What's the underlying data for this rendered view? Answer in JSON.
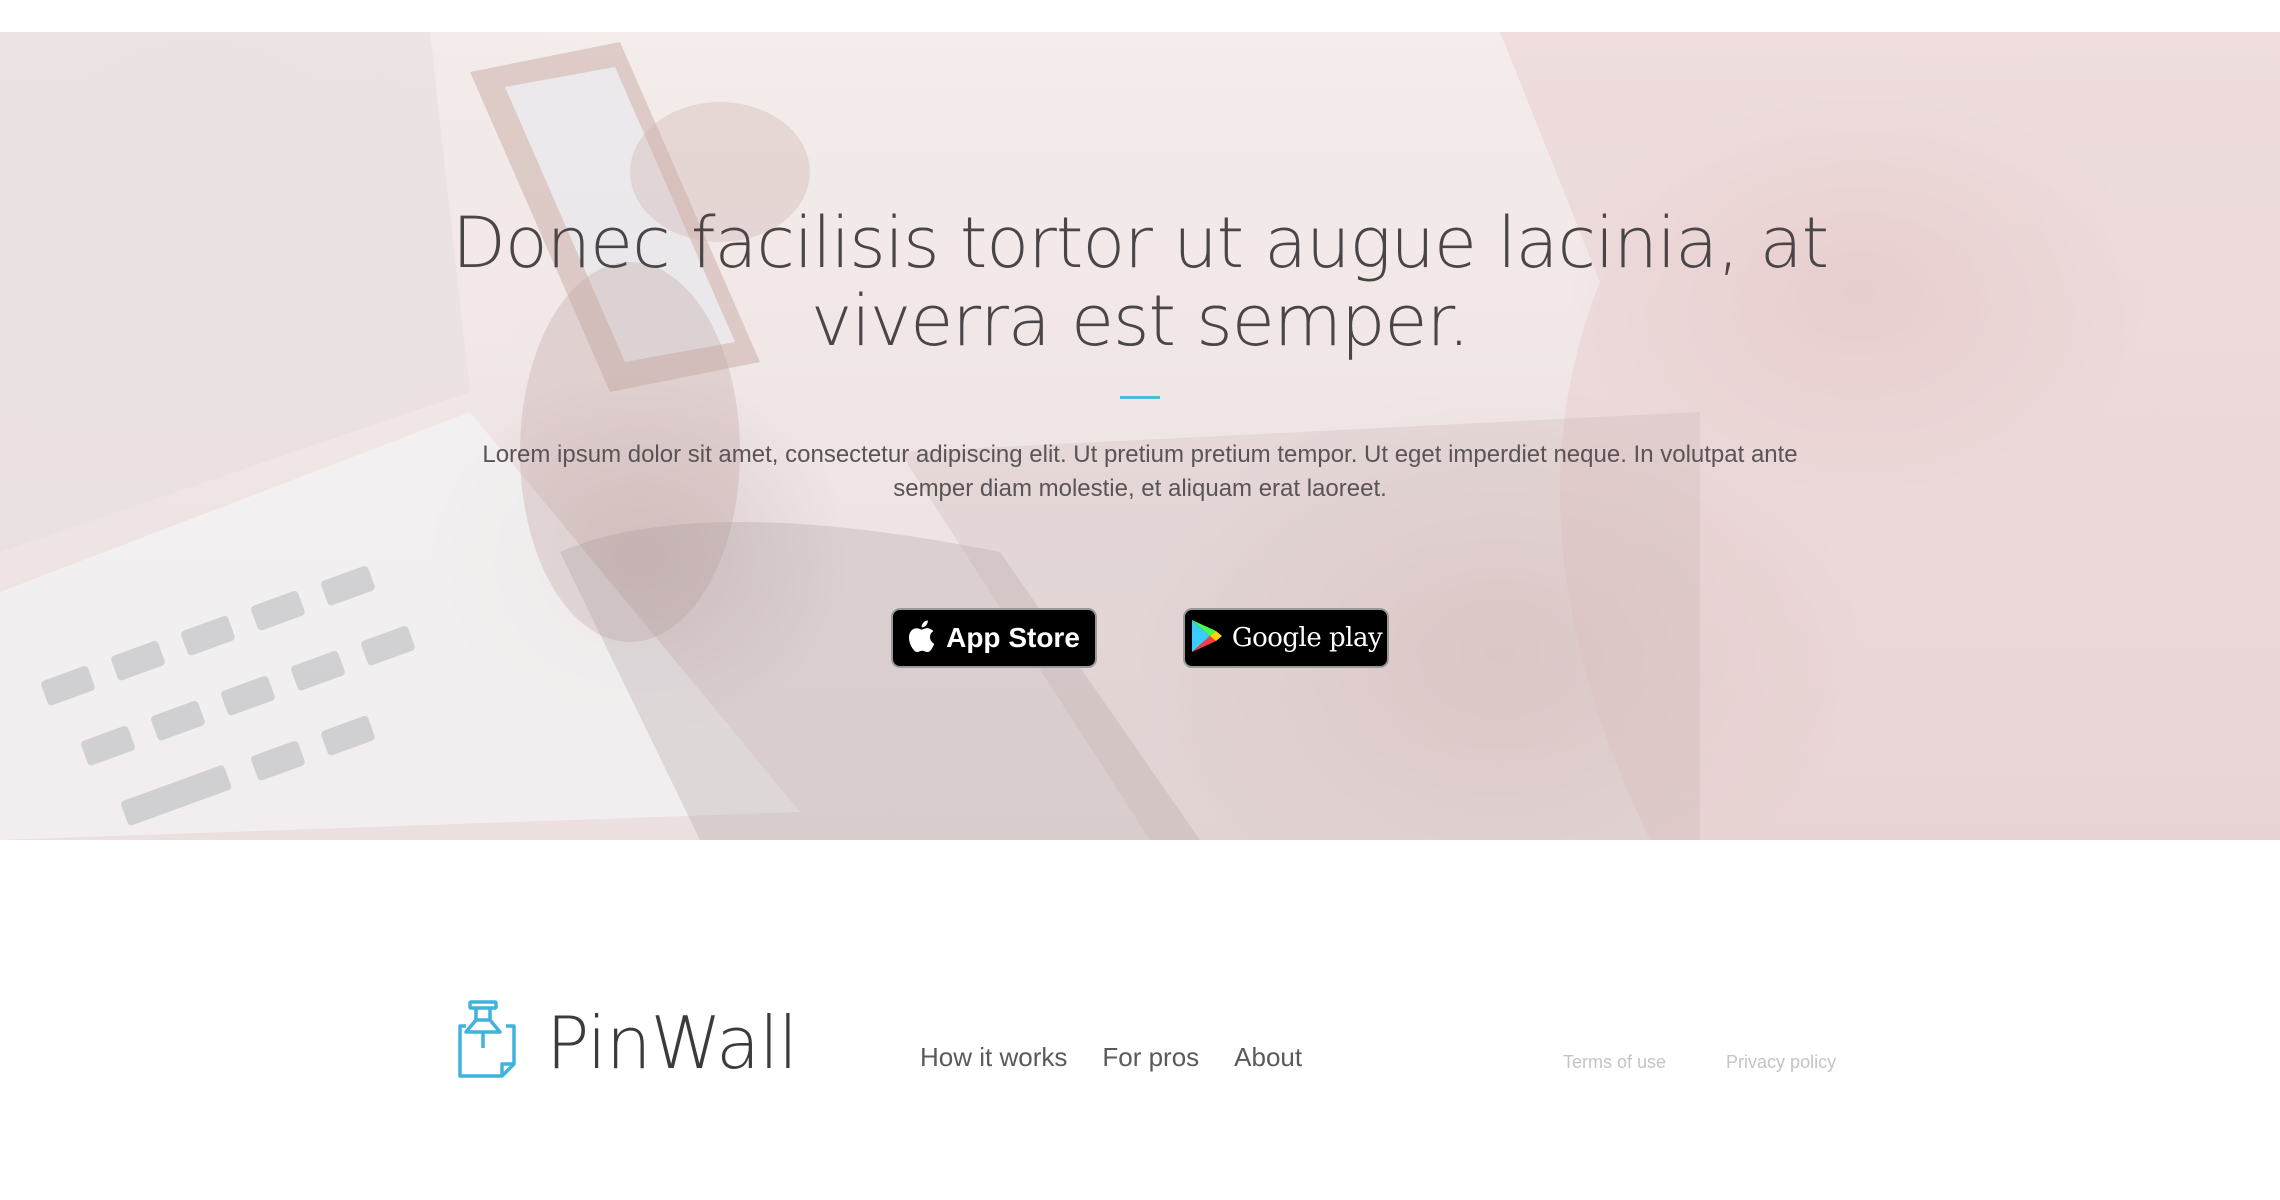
{
  "hero": {
    "title": "Donec facilisis tortor ut augue lacinia, at viverra est semper.",
    "description": "Lorem ipsum dolor sit amet, consectetur adipiscing elit. Ut pretium pretium tempor. Ut eget imperdiet neque. In volutpat ante semper diam molestie, et aliquam erat laoreet.",
    "accent_color": "#4fb9dc",
    "app_store_label": "App Store",
    "google_play_label": "Google play"
  },
  "footer": {
    "brand": "PinWall",
    "nav": [
      "How it works",
      "For pros",
      "About"
    ],
    "legal": [
      "Terms of use",
      "Privacy policy"
    ]
  }
}
